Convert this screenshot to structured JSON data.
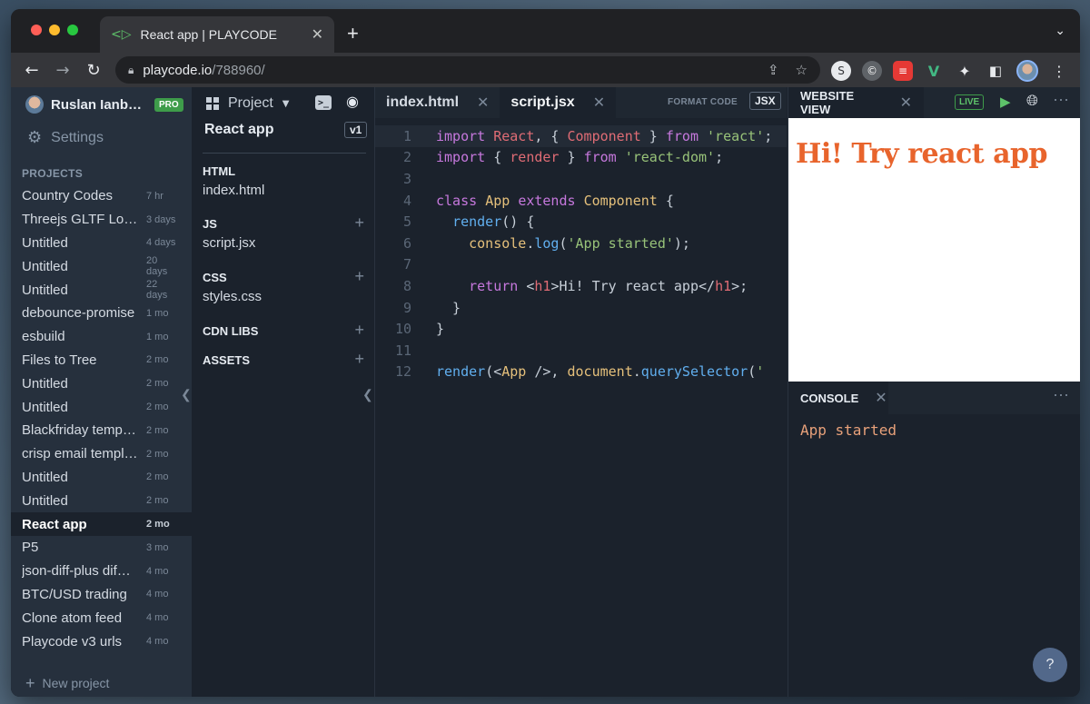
{
  "browser": {
    "tab_title": "React app | PLAYCODE",
    "tab_favicon": "playcode-logo-icon",
    "url_host": "playcode.io",
    "url_path": "/788960/"
  },
  "sidebar": {
    "user_name": "Ruslan Ianb…",
    "pro_badge": "PRO",
    "settings_label": "Settings",
    "projects_heading": "PROJECTS",
    "projects": [
      {
        "name": "Country Codes",
        "date": "7 hr"
      },
      {
        "name": "Threejs GLTF Lo…",
        "date": "3 days"
      },
      {
        "name": "Untitled",
        "date": "4 days"
      },
      {
        "name": "Untitled",
        "date": "20 days"
      },
      {
        "name": "Untitled",
        "date": "22 days"
      },
      {
        "name": "debounce-promise",
        "date": "1 mo"
      },
      {
        "name": "esbuild",
        "date": "1 mo"
      },
      {
        "name": "Files to Tree",
        "date": "2 mo"
      },
      {
        "name": "Untitled",
        "date": "2 mo"
      },
      {
        "name": "Untitled",
        "date": "2 mo"
      },
      {
        "name": "Blackfriday temp…",
        "date": "2 mo"
      },
      {
        "name": "crisp email templ…",
        "date": "2 mo"
      },
      {
        "name": "Untitled",
        "date": "2 mo"
      },
      {
        "name": "Untitled",
        "date": "2 mo"
      },
      {
        "name": "React app",
        "date": "2 mo",
        "active": true
      },
      {
        "name": "P5",
        "date": "3 mo"
      },
      {
        "name": "json-diff-plus dif…",
        "date": "4 mo"
      },
      {
        "name": "BTC/USD trading",
        "date": "4 mo"
      },
      {
        "name": "Clone atom feed",
        "date": "4 mo"
      },
      {
        "name": "Playcode v3 urls",
        "date": "4 mo"
      }
    ],
    "new_project_label": "New project"
  },
  "files": {
    "menu_label": "Project",
    "project_name": "React app",
    "version": "v1",
    "sections": [
      {
        "heading": "HTML",
        "file": "index.html",
        "addable": false
      },
      {
        "heading": "JS",
        "file": "script.jsx",
        "addable": true
      },
      {
        "heading": "CSS",
        "file": "styles.css",
        "addable": true
      },
      {
        "heading": "CDN LIBS",
        "file": "",
        "addable": true
      },
      {
        "heading": "ASSETS",
        "file": "",
        "addable": true
      }
    ]
  },
  "editor": {
    "tabs": [
      "index.html",
      "script.jsx"
    ],
    "active_tab": "script.jsx",
    "format_label": "FORMAT CODE",
    "lang_badge": "JSX",
    "line_numbers": [
      "1",
      "2",
      "3",
      "4",
      "5",
      "6",
      "7",
      "8",
      "9",
      "10",
      "11",
      "12"
    ]
  },
  "preview": {
    "tab_label": "WEBSITE VIEW",
    "live_badge": "LIVE",
    "heading": "Hi! Try react app",
    "heading_color": "#e8642c"
  },
  "console": {
    "tab_label": "CONSOLE",
    "output": "App started"
  },
  "help_label": "?",
  "colors": {
    "accent_green": "#3e9c4a",
    "sidebar_bg": "#26303d",
    "editor_bg": "#1b222c"
  }
}
